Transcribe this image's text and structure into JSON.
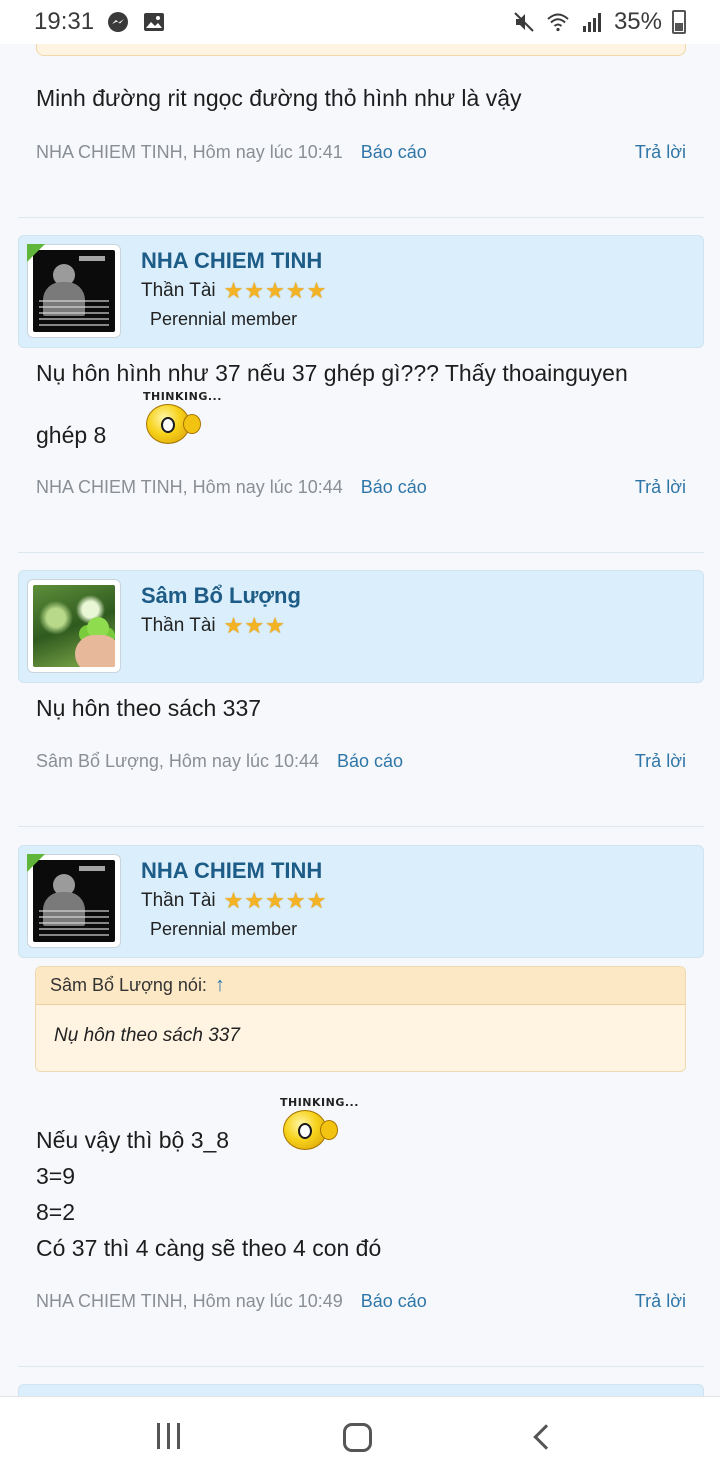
{
  "status_bar": {
    "time": "19:31",
    "battery": "35%",
    "icons": [
      "messenger-icon",
      "image-icon",
      "mute-icon",
      "wifi-icon",
      "signal-icon",
      "battery-icon"
    ]
  },
  "posts": [
    {
      "message": "Minh đường rit ngọc đường thỏ hình như là vậy",
      "meta": "NHA CHIEM TINH, Hôm nay lúc 10:41",
      "report": "Báo cáo",
      "reply": "Trả lời"
    },
    {
      "author": {
        "name": "NHA CHIEM TINH",
        "title": "Thần Tài",
        "stars": 5,
        "badge": "Perennial member"
      },
      "message_line1": "Nụ hôn hình như 37 nếu 37 ghép gì??? Thấy thoainguyen",
      "message_line2": "ghép 8",
      "smiley_label": "THINKING...",
      "meta": "NHA CHIEM TINH, Hôm nay lúc 10:44",
      "report": "Báo cáo",
      "reply": "Trả lời"
    },
    {
      "author": {
        "name": "Sâm Bổ Lượng",
        "title": "Thần Tài",
        "stars": 3
      },
      "message": "Nụ hôn theo sách 337",
      "meta": "Sâm Bổ Lượng, Hôm nay lúc 10:44",
      "report": "Báo cáo",
      "reply": "Trả lời"
    },
    {
      "author": {
        "name": "NHA CHIEM TINH",
        "title": "Thần Tài",
        "stars": 5,
        "badge": "Perennial member"
      },
      "quote": {
        "header": "Sâm Bổ Lượng nói:",
        "arrow": "↑",
        "text": "Nụ hôn theo sách 337"
      },
      "lines": [
        "Nếu vậy thì bộ 3_8",
        "3=9",
        "8=2",
        "Có 37 thì 4 càng sẽ theo 4 con đó"
      ],
      "smiley_label": "THINKING...",
      "meta": "NHA CHIEM TINH, Hôm nay lúc 10:49",
      "report": "Báo cáo",
      "reply": "Trả lời"
    }
  ],
  "colors": {
    "link": "#2f76a8",
    "author_name": "#1d5c87",
    "author_box": "#dbeefb",
    "quote_bg": "#fff4e2",
    "star": "#f4b324",
    "online": "#5fb63b"
  },
  "nav_bar": {
    "icons": [
      "recent-apps-icon",
      "home-icon",
      "back-icon"
    ]
  }
}
